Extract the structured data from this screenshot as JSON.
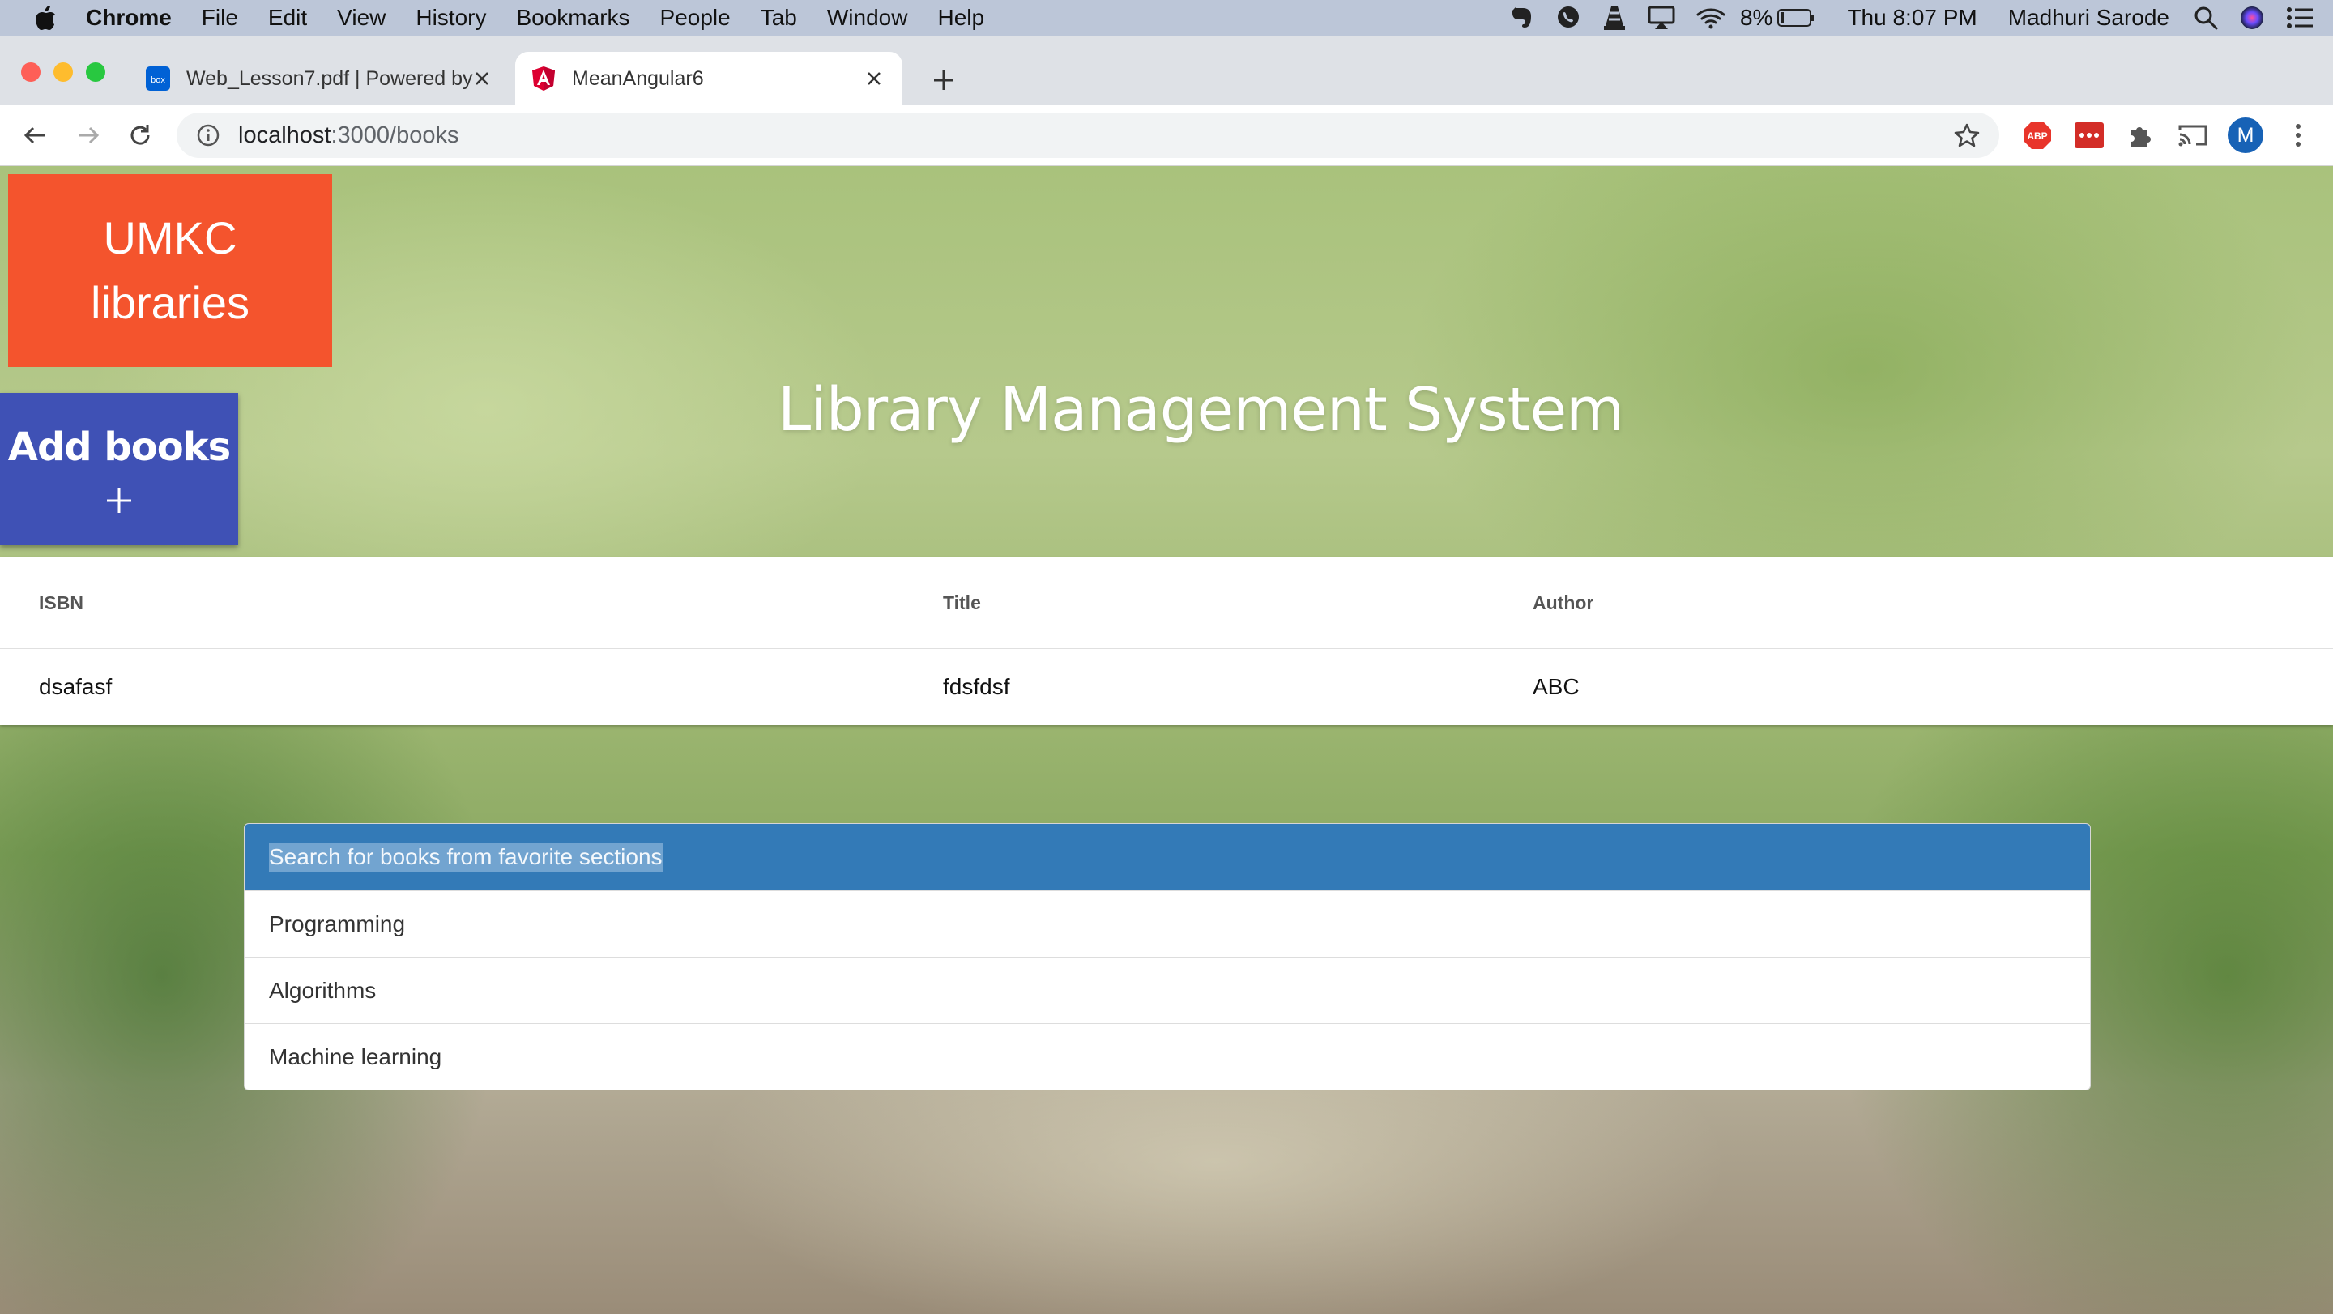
{
  "menubar": {
    "app_name": "Chrome",
    "menus": [
      "File",
      "Edit",
      "View",
      "History",
      "Bookmarks",
      "People",
      "Tab",
      "Window",
      "Help"
    ],
    "battery": "8%",
    "clock": "Thu 8:07 PM",
    "user": "Madhuri Sarode"
  },
  "tabs": [
    {
      "title": "Web_Lesson7.pdf | Powered by",
      "favicon": "box-icon",
      "active": false
    },
    {
      "title": "MeanAngular6",
      "favicon": "angular-icon",
      "active": true
    }
  ],
  "address_bar": {
    "host": "localhost",
    "path": ":3000/books"
  },
  "profile_initial": "M",
  "page": {
    "logo_line1": "UMKC",
    "logo_line2": "libraries",
    "add_books_label": "Add books",
    "heading": "Library Management System",
    "table": {
      "columns": [
        "ISBN",
        "Title",
        "Author"
      ],
      "rows": [
        [
          "dsafasf",
          "fdsfdsf",
          "ABC"
        ]
      ]
    },
    "sections": {
      "header": "Search for books from favorite sections",
      "items": [
        "Programming",
        "Algorithms",
        "Machine learning"
      ]
    }
  },
  "colors": {
    "logo_bg": "#f4542d",
    "add_books_bg": "#3f51b5",
    "sections_header_bg": "#337ab7"
  }
}
